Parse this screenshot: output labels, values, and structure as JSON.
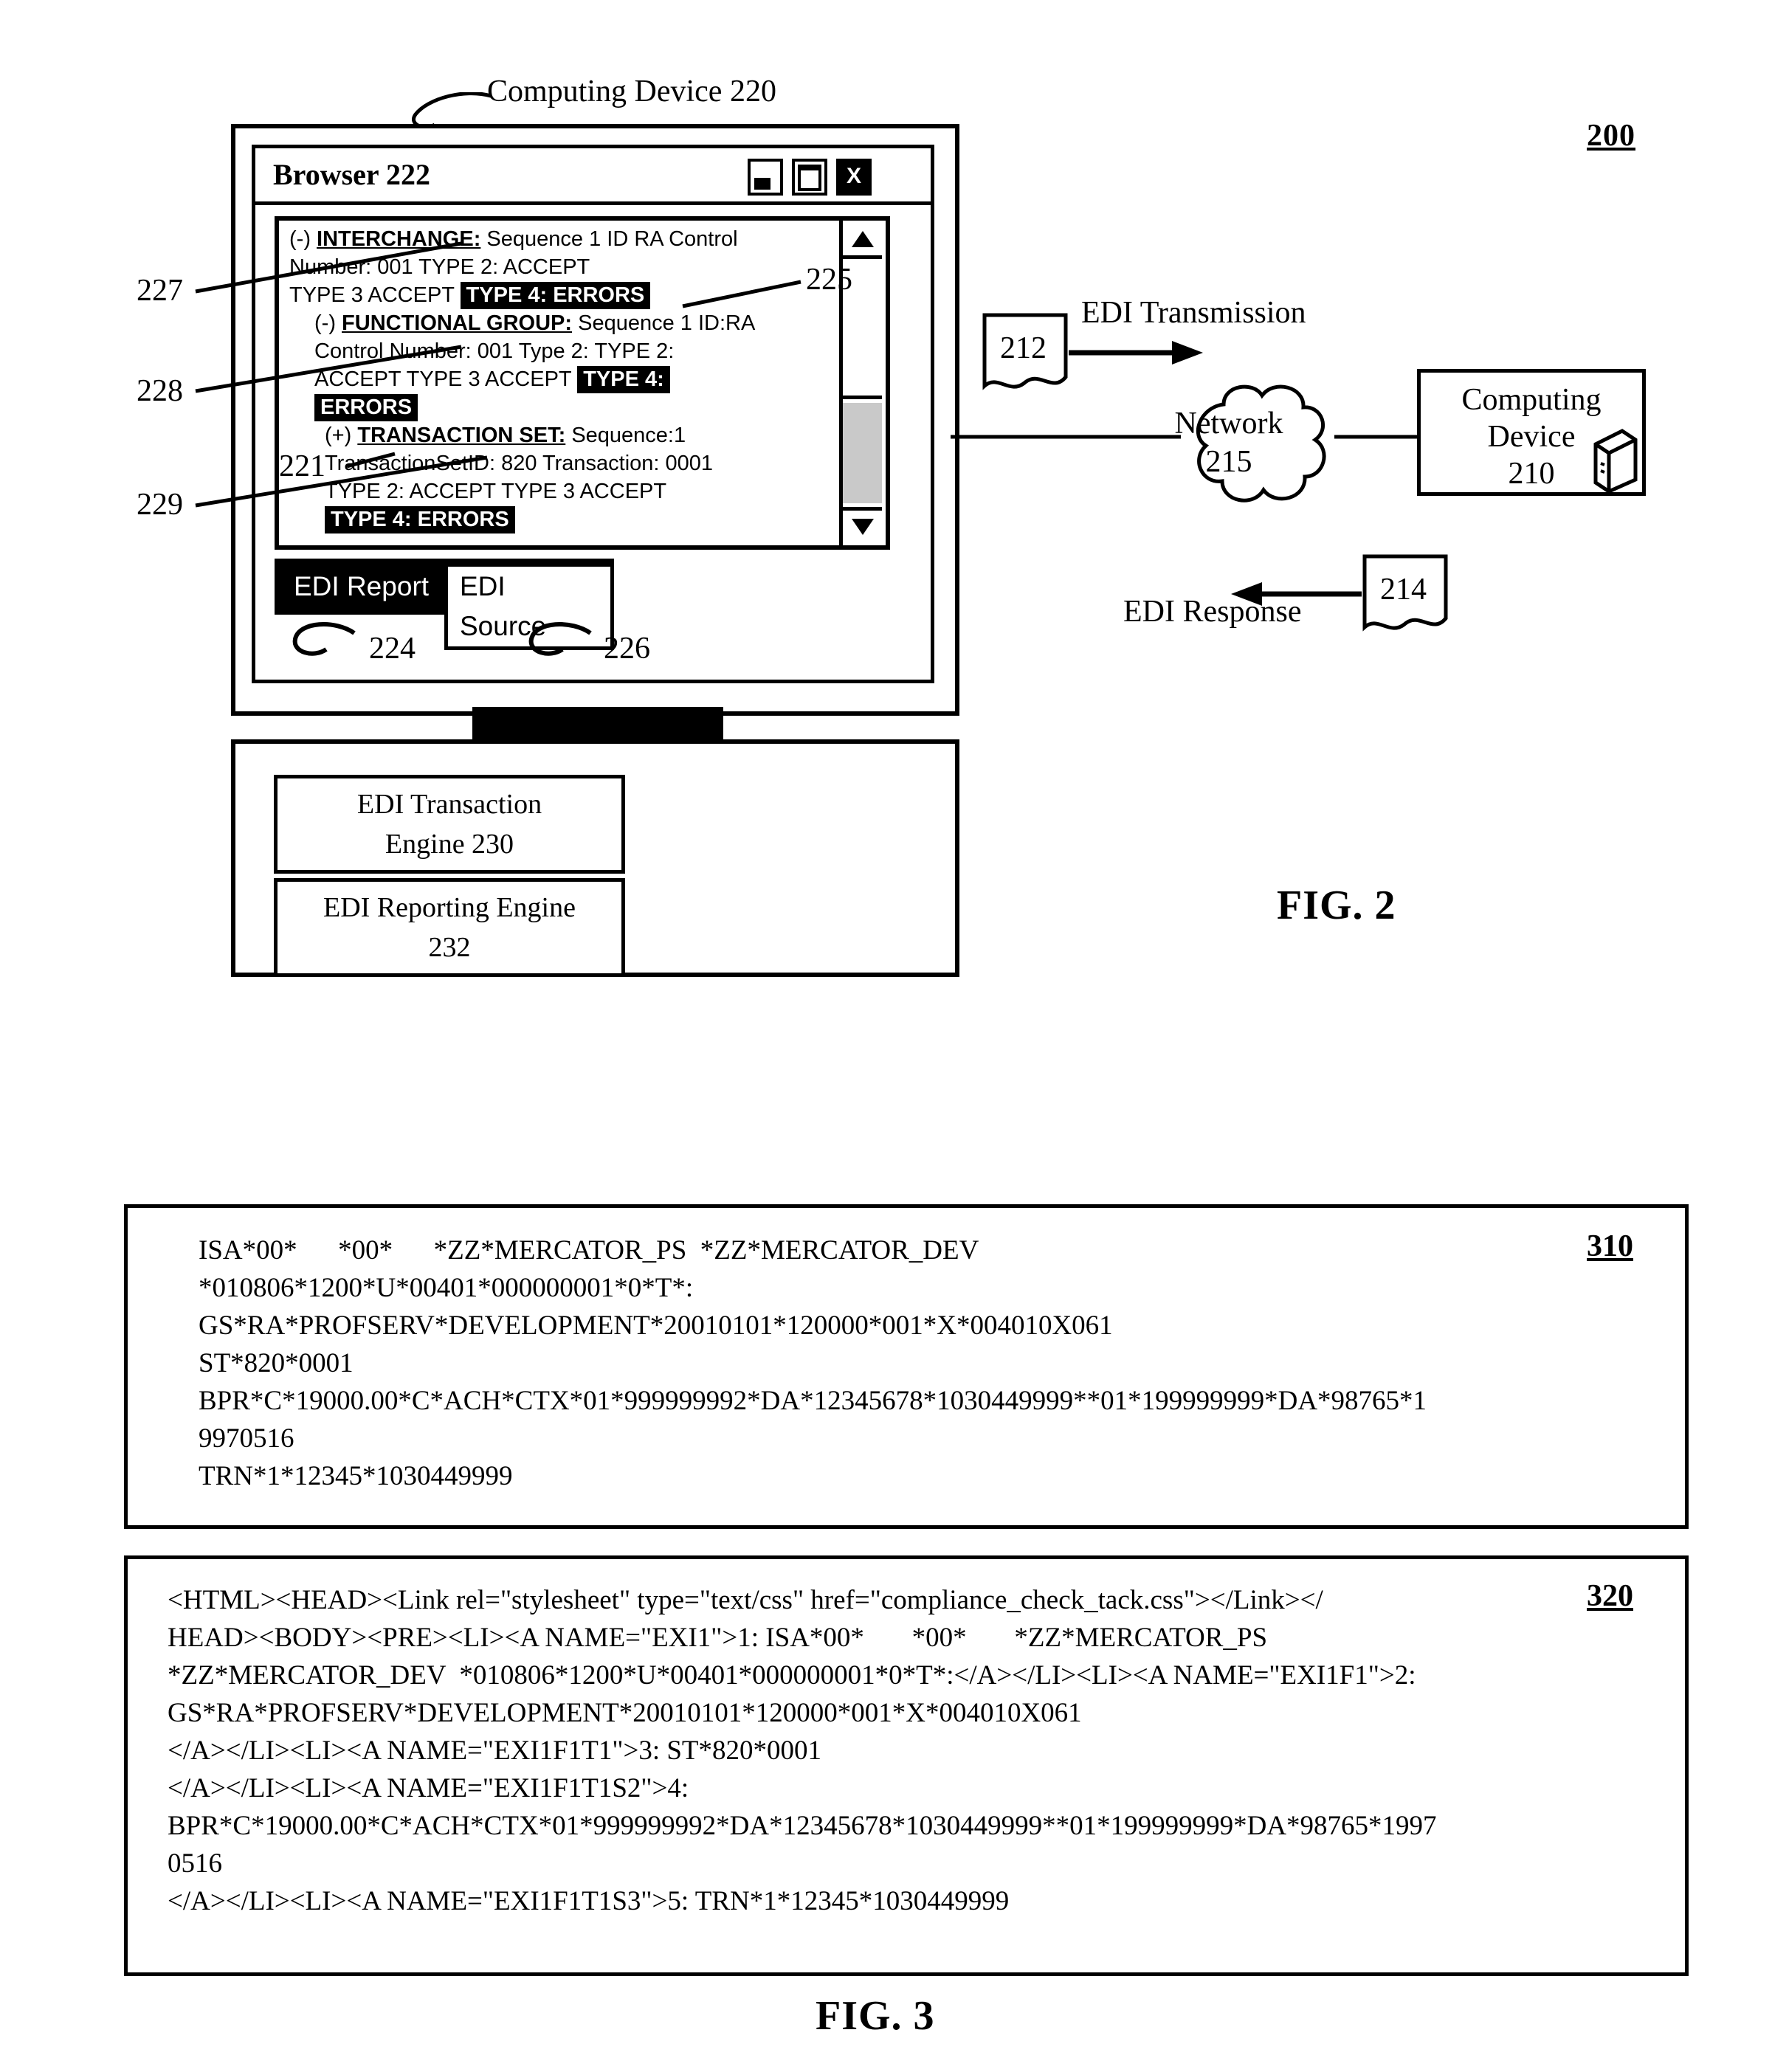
{
  "figure2": {
    "number": "200",
    "caption": "FIG. 2",
    "computing_device_label": "Computing Device 220",
    "browser": {
      "title": "Browser 222",
      "window_buttons": [
        "minimize-button",
        "maximize-button",
        "close-button"
      ],
      "close_glyph": "X",
      "tabs": [
        {
          "label": "EDI Report",
          "active": true,
          "ref": "224"
        },
        {
          "label": "EDI Source",
          "active": false,
          "ref": "226"
        }
      ],
      "report_tree": [
        {
          "indent": 1,
          "toggle": "(-)",
          "heading": "INTERCHANGE:",
          "text": " Sequence 1 ID RA Control"
        },
        {
          "indent": 1,
          "text": "Number: 001  TYPE 2: ACCEPT"
        },
        {
          "indent": 1,
          "text": "TYPE 3 ACCEPT ",
          "badge": "TYPE 4: ERRORS"
        },
        {
          "indent": 2,
          "toggle": "(-)",
          "heading": "FUNCTIONAL GROUP:",
          "text": " Sequence 1 ID:RA"
        },
        {
          "indent": 2,
          "text": "Control Number: 001 Type 2: TYPE 2:"
        },
        {
          "indent": 2,
          "text": "ACCEPT TYPE 3 ACCEPT  ",
          "badge": "TYPE 4:"
        },
        {
          "indent": 2,
          "badge": "ERRORS"
        },
        {
          "indent": 3,
          "toggle": "(+)",
          "heading": "TRANSACTION SET:",
          "text": " Sequence:1"
        },
        {
          "indent": 3,
          "text": "TransactionSetID: 820  Transaction: 0001"
        },
        {
          "indent": 3,
          "text": "TYPE 2: ACCEPT TYPE 3 ACCEPT"
        },
        {
          "indent": 3,
          "badge": "TYPE 4: ERRORS"
        }
      ],
      "scrollbar": {
        "up_arrow": "▲",
        "down_arrow": "▼"
      }
    },
    "leader_refs": {
      "interchange": "227",
      "functional_group": "228",
      "transaction_set": "229",
      "tree_node": "221",
      "error_badge": "225",
      "tab_report": "224",
      "tab_source": "226"
    },
    "engines": [
      {
        "label_line1": "EDI Transaction",
        "label_line2": "Engine 230"
      },
      {
        "label_line1": "EDI Reporting Engine",
        "label_line2": "232"
      }
    ],
    "network": {
      "edi_transmission_label": "EDI Transmission",
      "edi_transmission_ref": "212",
      "edi_response_label": "EDI Response",
      "edi_response_ref": "214",
      "cloud_line1": "Network",
      "cloud_line2": "215",
      "remote_device_line1": "Computing",
      "remote_device_line2": "Device",
      "remote_device_line3": "210"
    }
  },
  "figure3": {
    "caption": "FIG. 3",
    "box310": {
      "ref": "310",
      "lines": [
        "ISA*00*      *00*      *ZZ*MERCATOR_PS  *ZZ*MERCATOR_DEV",
        "*010806*1200*U*00401*000000001*0*T*:",
        "GS*RA*PROFSERV*DEVELOPMENT*20010101*120000*001*X*004010X061",
        "ST*820*0001",
        "BPR*C*19000.00*C*ACH*CTX*01*999999992*DA*12345678*1030449999**01*199999999*DA*98765*1",
        "9970516",
        "TRN*1*12345*1030449999"
      ]
    },
    "box320": {
      "ref": "320",
      "lines": [
        "<HTML><HEAD><Link rel=\"stylesheet\" type=\"text/css\" href=\"compliance_check_tack.css\"></Link></",
        "HEAD><BODY><PRE><LI><A NAME=\"EXI1\">1: ISA*00*       *00*       *ZZ*MERCATOR_PS",
        "*ZZ*MERCATOR_DEV  *010806*1200*U*00401*000000001*0*T*:</A></LI><LI><A NAME=\"EXI1F1\">2:",
        "GS*RA*PROFSERV*DEVELOPMENT*20010101*120000*001*X*004010X061",
        "</A></LI><LI><A NAME=\"EXI1F1T1\">3: ST*820*0001",
        "</A></LI><LI><A NAME=\"EXI1F1T1S2\">4:",
        "BPR*C*19000.00*C*ACH*CTX*01*999999992*DA*12345678*1030449999**01*199999999*DA*98765*1997",
        "0516",
        "</A></LI><LI><A NAME=\"EXI1F1T1S3\">5: TRN*1*12345*1030449999"
      ]
    }
  }
}
